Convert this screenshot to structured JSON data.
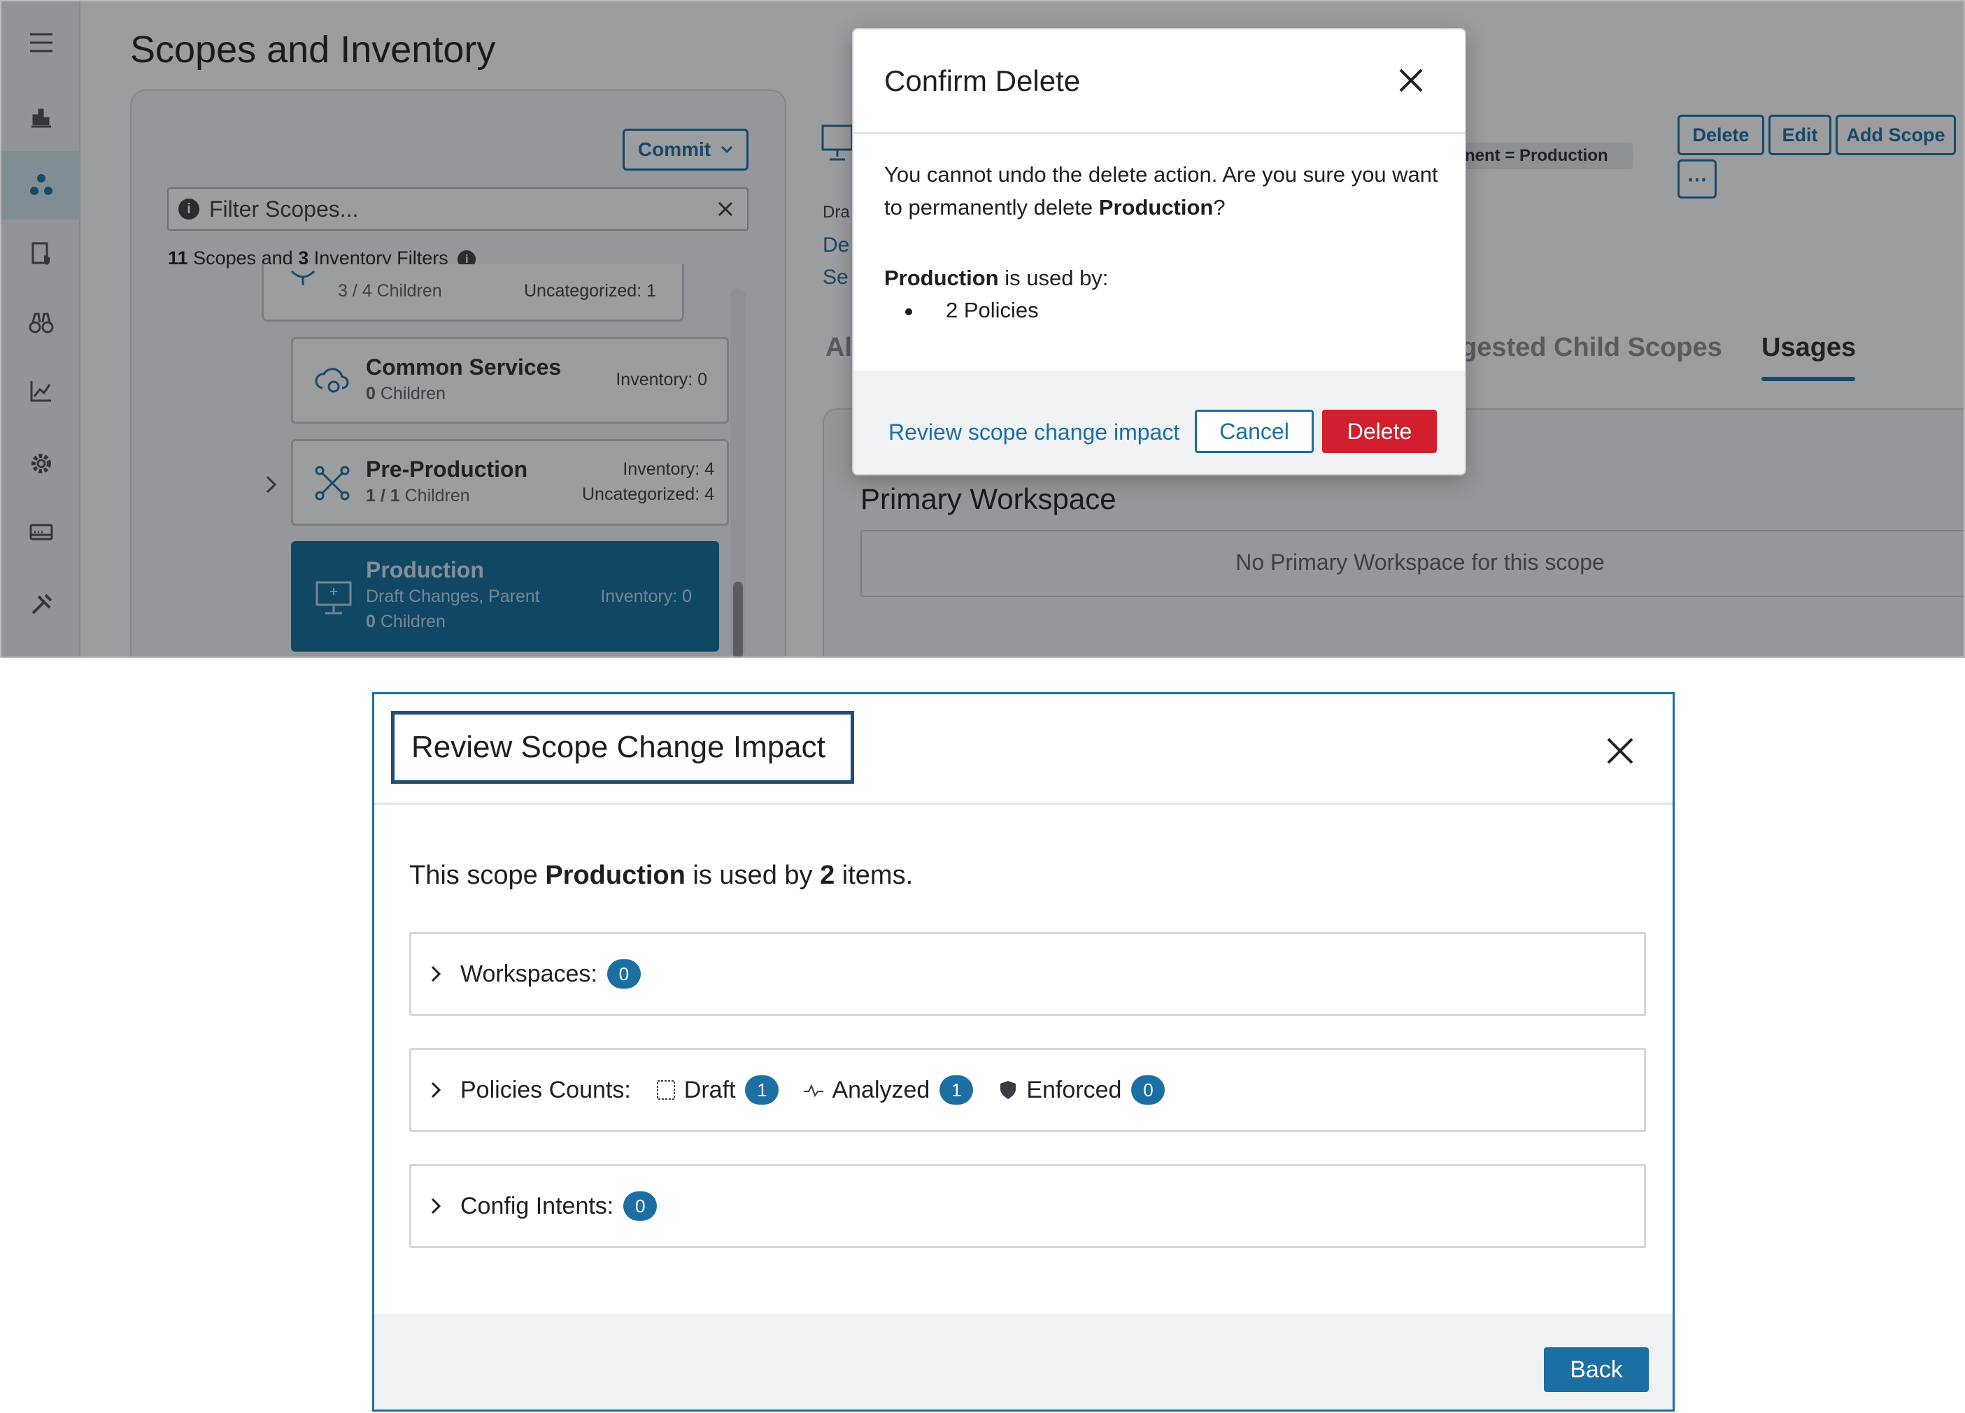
{
  "top_screen": {
    "page_title": "Scopes and Inventory",
    "commit_label": "Commit",
    "filter_placeholder": "Filter Scopes...",
    "scope_count": {
      "scopes": "11",
      "scopes_text": "Scopes and",
      "filters": "3",
      "filters_text": "Inventory Filters"
    },
    "partial_card": {
      "children": "3 / 4 Children",
      "uncategorized": "Uncategorized: 1"
    },
    "cards": [
      {
        "name": "Common Services",
        "children_count": "0",
        "children_label": "Children",
        "inventory": "Inventory: 0",
        "uncategorized": ""
      },
      {
        "name": "Pre-Production",
        "children_count": "1 / 1",
        "children_label": "Children",
        "inventory": "Inventory: 4",
        "uncategorized": "Uncategorized: 4"
      },
      {
        "name": "Production",
        "status": "Draft Changes, Parent",
        "children_count": "0",
        "children_label": "Children",
        "inventory": "Inventory: 0"
      }
    ],
    "actions": {
      "delete": "Delete",
      "edit": "Edit",
      "add_scope": "Add Scope",
      "more": "⋯"
    },
    "env_filter": "nent = Production",
    "detail_peek": {
      "draft": "Dra",
      "link1": "De",
      "link2": "Se"
    },
    "tabs": {
      "all_partial": "Al",
      "child_partial": "gested Child Scopes",
      "usages": "Usages"
    },
    "primary_workspace": {
      "title": "Primary Workspace",
      "empty": "No Primary Workspace for this scope"
    }
  },
  "confirm_modal": {
    "title": "Confirm Delete",
    "message_part1": "You cannot undo the delete action. Are you sure you want to permanently delete",
    "scope_name": "Production",
    "message_end": "?",
    "used_by_name": "Production",
    "used_by_text": "is used by:",
    "bullets": [
      "2 Policies"
    ],
    "review_link": "Review scope change impact",
    "cancel_label": "Cancel",
    "delete_label": "Delete"
  },
  "review_dialog": {
    "title": "Review Scope Change Impact",
    "summary": {
      "prefix": "This scope",
      "scope": "Production",
      "middle": "is used by",
      "count": "2",
      "suffix": "items."
    },
    "workspaces": {
      "label": "Workspaces:",
      "count": "0"
    },
    "policies": {
      "label": "Policies Counts:",
      "draft_label": "Draft",
      "draft_count": "1",
      "analyzed_label": "Analyzed",
      "analyzed_count": "1",
      "enforced_label": "Enforced",
      "enforced_count": "0"
    },
    "config_intents": {
      "label": "Config Intents:",
      "count": "0"
    },
    "back_label": "Back"
  },
  "colors": {
    "accent": "#1b6fa3",
    "danger": "#d11f2e",
    "selected_card": "#0f6c99"
  }
}
